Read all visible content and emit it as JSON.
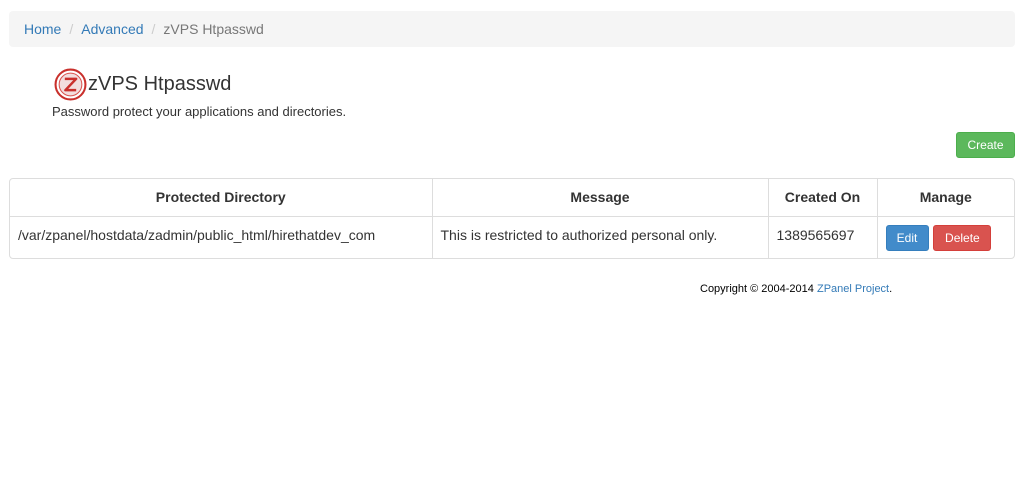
{
  "breadcrumb": {
    "items": [
      "Home",
      "Advanced"
    ],
    "separator": "/",
    "current": "zVPS Htpasswd"
  },
  "module": {
    "icon": "zpanel-logo-icon",
    "title": "zVPS Htpasswd",
    "description": "Password protect your applications and directories."
  },
  "actions": {
    "create_label": "Create"
  },
  "table": {
    "headers": [
      "Protected Directory",
      "Message",
      "Created On",
      "Manage"
    ],
    "rows": [
      {
        "directory": "/var/zpanel/hostdata/zadmin/public_html/hirethatdev_com",
        "message": "This is restricted to authorized personal only.",
        "created_on": "1389565697",
        "edit_label": "Edit",
        "delete_label": "Delete"
      }
    ]
  },
  "footer": {
    "prefix": "Copyright © 2004-2014 ",
    "link": "ZPanel Project",
    "suffix": "."
  },
  "colors": {
    "link": "#337ab7",
    "success": "#5cb85c",
    "primary": "#428bca",
    "danger": "#d9534f"
  }
}
